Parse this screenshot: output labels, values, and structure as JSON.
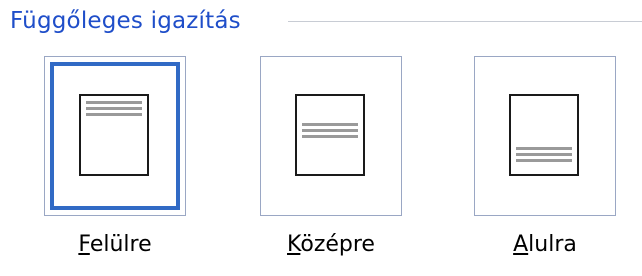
{
  "group": {
    "title": "Függőleges igazítás"
  },
  "options": [
    {
      "accel": "F",
      "rest": "elülre",
      "alignment": "top",
      "selected": true
    },
    {
      "accel": "K",
      "rest": "özépre",
      "alignment": "middle",
      "selected": false
    },
    {
      "accel": "A",
      "rest": "lulra",
      "alignment": "bottom",
      "selected": false
    }
  ],
  "colors": {
    "title": "#1f4ec9",
    "selection": "#316ac5",
    "frame_border": "#9aa7c4",
    "text_lines": "#9a9a9a"
  }
}
